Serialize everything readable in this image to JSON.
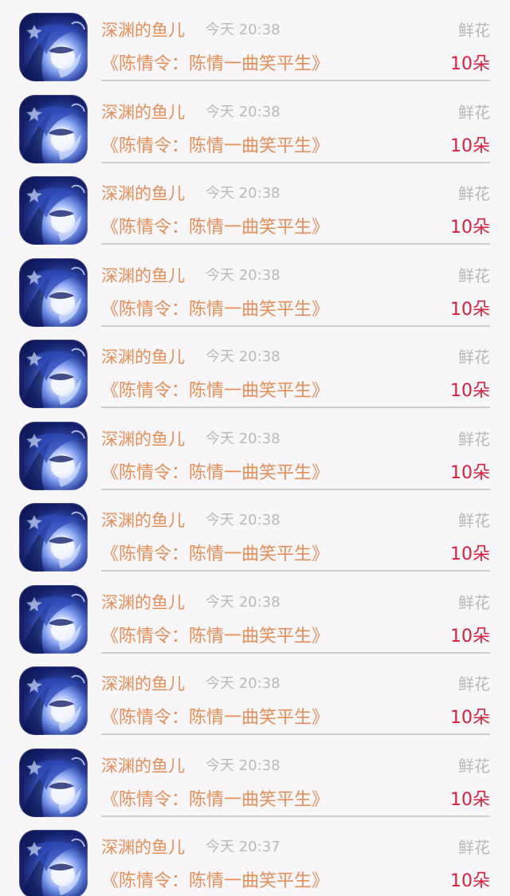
{
  "gift_records": [
    {
      "user": "深渊的鱼儿",
      "time": "今天 20:38",
      "gift": "鲜花",
      "title": "《陈情令：陈情一曲笑平生》",
      "count": "10朵",
      "avatar_icon": "anime-avatar-icon"
    },
    {
      "user": "深渊的鱼儿",
      "time": "今天 20:38",
      "gift": "鲜花",
      "title": "《陈情令：陈情一曲笑平生》",
      "count": "10朵",
      "avatar_icon": "anime-avatar-icon"
    },
    {
      "user": "深渊的鱼儿",
      "time": "今天 20:38",
      "gift": "鲜花",
      "title": "《陈情令：陈情一曲笑平生》",
      "count": "10朵",
      "avatar_icon": "anime-avatar-icon"
    },
    {
      "user": "深渊的鱼儿",
      "time": "今天 20:38",
      "gift": "鲜花",
      "title": "《陈情令：陈情一曲笑平生》",
      "count": "10朵",
      "avatar_icon": "anime-avatar-icon"
    },
    {
      "user": "深渊的鱼儿",
      "time": "今天 20:38",
      "gift": "鲜花",
      "title": "《陈情令：陈情一曲笑平生》",
      "count": "10朵",
      "avatar_icon": "anime-avatar-icon"
    },
    {
      "user": "深渊的鱼儿",
      "time": "今天 20:38",
      "gift": "鲜花",
      "title": "《陈情令：陈情一曲笑平生》",
      "count": "10朵",
      "avatar_icon": "anime-avatar-icon"
    },
    {
      "user": "深渊的鱼儿",
      "time": "今天 20:38",
      "gift": "鲜花",
      "title": "《陈情令：陈情一曲笑平生》",
      "count": "10朵",
      "avatar_icon": "anime-avatar-icon"
    },
    {
      "user": "深渊的鱼儿",
      "time": "今天 20:38",
      "gift": "鲜花",
      "title": "《陈情令：陈情一曲笑平生》",
      "count": "10朵",
      "avatar_icon": "anime-avatar-icon"
    },
    {
      "user": "深渊的鱼儿",
      "time": "今天 20:38",
      "gift": "鲜花",
      "title": "《陈情令：陈情一曲笑平生》",
      "count": "10朵",
      "avatar_icon": "anime-avatar-icon"
    },
    {
      "user": "深渊的鱼儿",
      "time": "今天 20:38",
      "gift": "鲜花",
      "title": "《陈情令：陈情一曲笑平生》",
      "count": "10朵",
      "avatar_icon": "anime-avatar-icon"
    },
    {
      "user": "深渊的鱼儿",
      "time": "今天 20:37",
      "gift": "鲜花",
      "title": "《陈情令：陈情一曲笑平生》",
      "count": "10朵",
      "avatar_icon": "anime-avatar-icon"
    }
  ],
  "colors": {
    "background": "#f8f6f8",
    "primary_orange": "#e58e56",
    "muted_gray": "#b9b9b9",
    "count_red": "#d81f3d",
    "divider": "#cfcfcf"
  }
}
